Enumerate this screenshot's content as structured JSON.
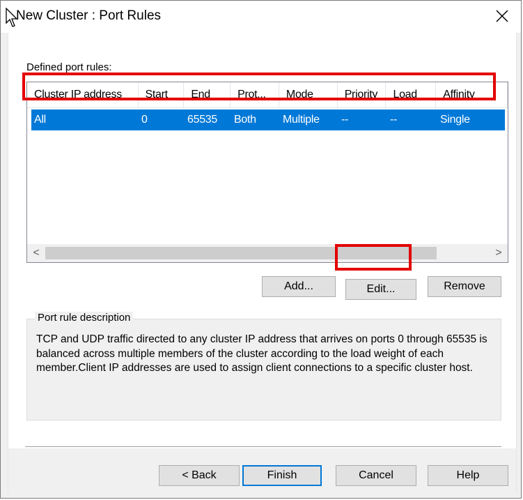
{
  "window": {
    "title": "New Cluster :  Port Rules",
    "close_glyph": "✕"
  },
  "port_rules": {
    "label": "Defined port rules:",
    "columns": [
      "Cluster IP address",
      "Start",
      "End",
      "Prot...",
      "Mode",
      "Priority",
      "Load",
      "Affinity"
    ],
    "rows": [
      {
        "cluster_ip": "All",
        "start": "0",
        "end": "65535",
        "protocol": "Both",
        "mode": "Multiple",
        "priority": "--",
        "load": "--",
        "affinity": "Single"
      }
    ],
    "scroll_left": "<",
    "scroll_right": ">"
  },
  "buttons": {
    "add": "Add...",
    "edit": "Edit...",
    "remove": "Remove",
    "back": "< Back",
    "finish": "Finish",
    "cancel": "Cancel",
    "help": "Help"
  },
  "description": {
    "title": "Port rule description",
    "text": "TCP and UDP traffic directed to any cluster IP address that arrives on ports 0 through 65535 is balanced across multiple members of the cluster according to the load weight of each member.Client IP addresses are used to assign client connections to a specific cluster host."
  },
  "colors": {
    "selection": "#0078d7",
    "highlight_outline": "#e30000",
    "default_button_border": "#0078d7"
  }
}
